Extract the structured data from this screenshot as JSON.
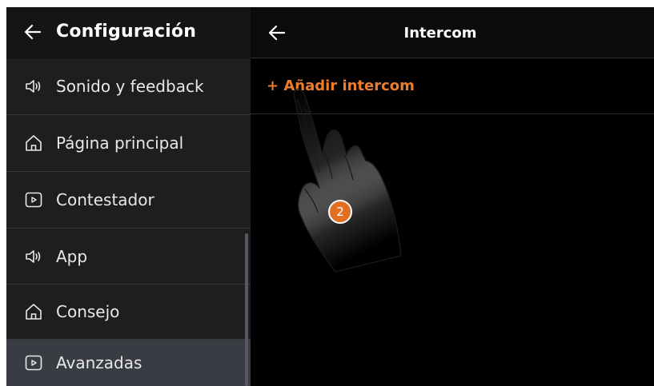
{
  "sidebar": {
    "title": "Configuración",
    "items": [
      {
        "label": "Sonido y feedback",
        "icon": "speaker-icon"
      },
      {
        "label": "Página principal",
        "icon": "home-icon"
      },
      {
        "label": "Contestador",
        "icon": "play-box-icon"
      },
      {
        "label": "App",
        "icon": "speaker-icon"
      },
      {
        "label": "Consejo",
        "icon": "home-icon"
      },
      {
        "label": "Avanzadas",
        "icon": "play-box-icon"
      }
    ]
  },
  "main": {
    "title": "Intercom",
    "add_label": "+ Añadir intercom"
  },
  "overlay": {
    "step_number": "2"
  },
  "colors": {
    "accent": "#ee7d2b",
    "panel_bg": "#1d1e20",
    "active_item_bg": "#3a3c44",
    "screen_bg": "#000000"
  }
}
